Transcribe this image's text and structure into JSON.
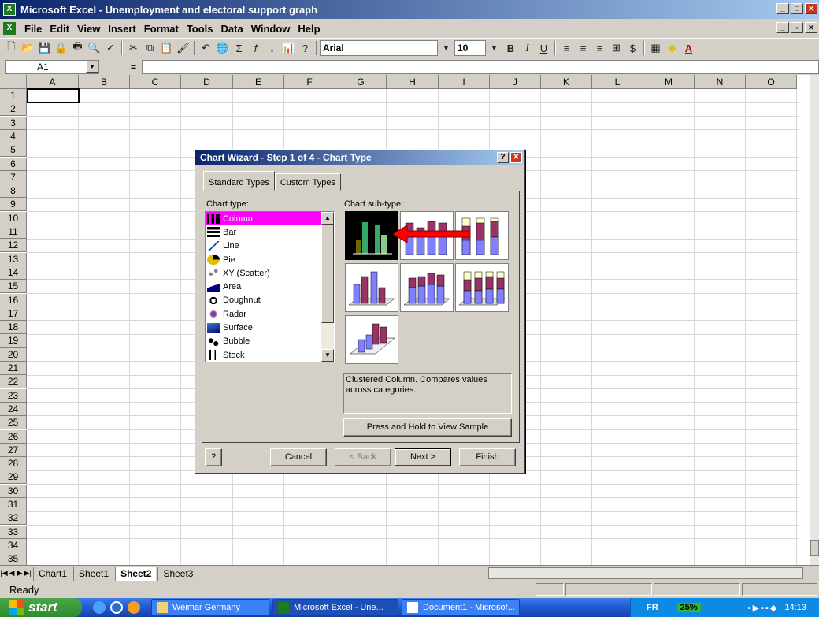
{
  "window": {
    "title": "Microsoft Excel - Unemployment and electoral support graph"
  },
  "menu": [
    "File",
    "Edit",
    "View",
    "Insert",
    "Format",
    "Tools",
    "Data",
    "Window",
    "Help"
  ],
  "toolbar": {
    "font": "Arial",
    "size": "10",
    "bold": "B",
    "italic": "I",
    "underline": "U"
  },
  "formula": {
    "cell_ref": "A1",
    "eq": "="
  },
  "grid": {
    "columns": [
      "A",
      "B",
      "C",
      "D",
      "E",
      "F",
      "G",
      "H",
      "I",
      "J",
      "K",
      "L",
      "M",
      "N",
      "O"
    ],
    "rows": [
      "1",
      "2",
      "3",
      "4",
      "5",
      "6",
      "7",
      "8",
      "9",
      "10",
      "11",
      "12",
      "13",
      "14",
      "15",
      "16",
      "17",
      "18",
      "19",
      "20",
      "21",
      "22",
      "23",
      "24",
      "25",
      "26",
      "27",
      "28",
      "29",
      "30",
      "31",
      "32",
      "33",
      "34",
      "35"
    ]
  },
  "sheets": [
    "Chart1",
    "Sheet1",
    "Sheet2",
    "Sheet3"
  ],
  "active_sheet": "Sheet2",
  "status": "Ready",
  "dialog": {
    "title": "Chart Wizard - Step 1 of 4 - Chart Type",
    "tabs": [
      "Standard Types",
      "Custom Types"
    ],
    "chart_type_label": "Chart type:",
    "subtype_label": "Chart sub-type:",
    "chart_types": [
      "Column",
      "Bar",
      "Line",
      "Pie",
      "XY (Scatter)",
      "Area",
      "Doughnut",
      "Radar",
      "Surface",
      "Bubble",
      "Stock"
    ],
    "selected_type": "Column",
    "description": "Clustered Column. Compares values across categories.",
    "sample_button": "Press and Hold to View Sample",
    "buttons": {
      "cancel": "Cancel",
      "back": "< Back",
      "next": "Next >",
      "finish": "Finish"
    }
  },
  "taskbar": {
    "start": "start",
    "tasks": [
      "Weimar Germany",
      "Microsoft Excel - Une...",
      "Document1 - Microsof..."
    ],
    "lang": "FR",
    "battery": "25%",
    "clock": "14:13"
  },
  "colors": {
    "title_start": "#0a246a",
    "title_end": "#a6caf0",
    "selection": "#ff00ff",
    "arrow": "#ff0000"
  }
}
